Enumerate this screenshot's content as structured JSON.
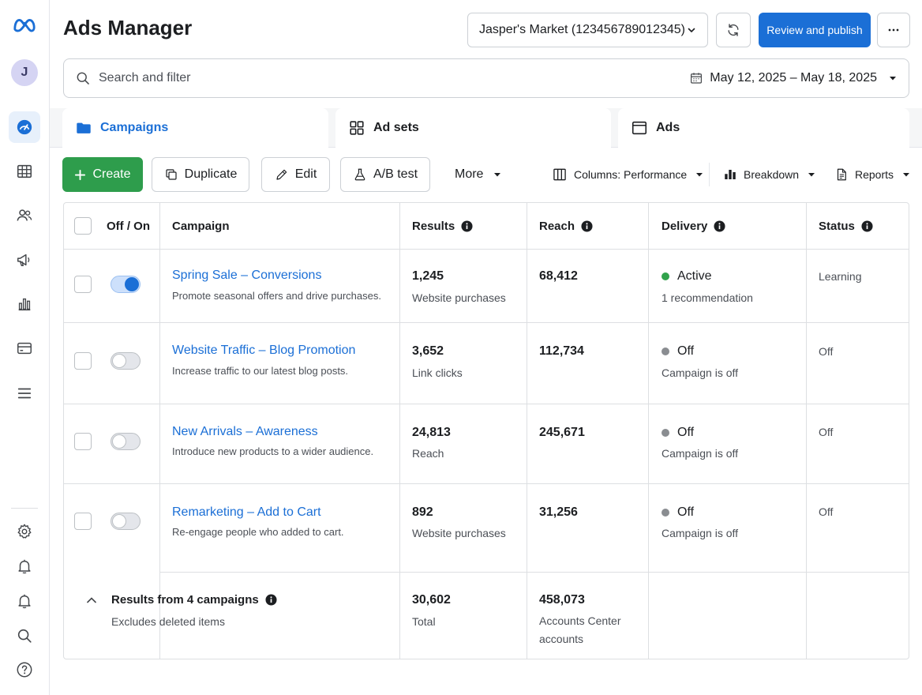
{
  "header": {
    "title": "Ads Manager",
    "account": "Jasper's Market (123456789012345)",
    "publish_label": "Review and publish"
  },
  "user": {
    "initial": "J"
  },
  "search": {
    "placeholder": "Search and filter",
    "date_range": "May 12, 2025 – May 18, 2025"
  },
  "tabs": [
    {
      "label": "Campaigns",
      "icon": "folder-icon",
      "active": true
    },
    {
      "label": "Ad sets",
      "icon": "grid-icon",
      "active": false
    },
    {
      "label": "Ads",
      "icon": "ad-window-icon",
      "active": false
    }
  ],
  "toolbar": {
    "create": "Create",
    "duplicate": "Duplicate",
    "edit": "Edit",
    "ab_test": "A/B test",
    "more": "More",
    "columns": "Columns: Performance",
    "breakdown": "Breakdown",
    "reports": "Reports"
  },
  "table": {
    "headers": {
      "toggle": "Off / On",
      "campaign": "Campaign",
      "results": "Results",
      "reach": "Reach",
      "delivery": "Delivery",
      "status": "Status"
    },
    "rows": [
      {
        "name": "Spring Sale – Conversions",
        "description": "Promote seasonal offers and drive purchases.",
        "on": true,
        "results": "1,245",
        "results_type": "Website purchases",
        "reach": "68,412",
        "delivery": "Active",
        "delivery_sub": "1 recommendation",
        "delivery_color": "#31a24c",
        "status": "Learning"
      },
      {
        "name": "Website Traffic – Blog Promotion",
        "description": "Increase traffic to our latest blog posts.",
        "on": false,
        "results": "3,652",
        "results_type": "Link clicks",
        "reach": "112,734",
        "delivery": "Off",
        "delivery_sub": "Campaign is off",
        "delivery_color": "#8a8d91",
        "status": "Off"
      },
      {
        "name": "New Arrivals – Awareness",
        "description": "Introduce new products to a wider audience.",
        "on": false,
        "results": "24,813",
        "results_type": "Reach",
        "reach": "245,671",
        "delivery": "Off",
        "delivery_sub": "Campaign is off",
        "delivery_color": "#8a8d91",
        "status": "Off"
      },
      {
        "name": "Remarketing – Add to Cart",
        "description": "Re-engage people who added to cart.",
        "on": false,
        "results": "892",
        "results_type": "Website purchases",
        "reach": "31,256",
        "delivery": "Off",
        "delivery_sub": "Campaign is off",
        "delivery_color": "#8a8d91",
        "status": "Off"
      }
    ],
    "footer": {
      "title": "Results from 4 campaigns",
      "subtitle": "Excludes deleted items",
      "results_total": "30,602",
      "results_label": "Total",
      "reach_total": "458,073",
      "reach_label": "Accounts Center accounts"
    }
  },
  "colors": {
    "primary": "#1b6fd6",
    "create": "#2e9d4c",
    "active": "#31a24c",
    "off": "#8a8d91"
  }
}
